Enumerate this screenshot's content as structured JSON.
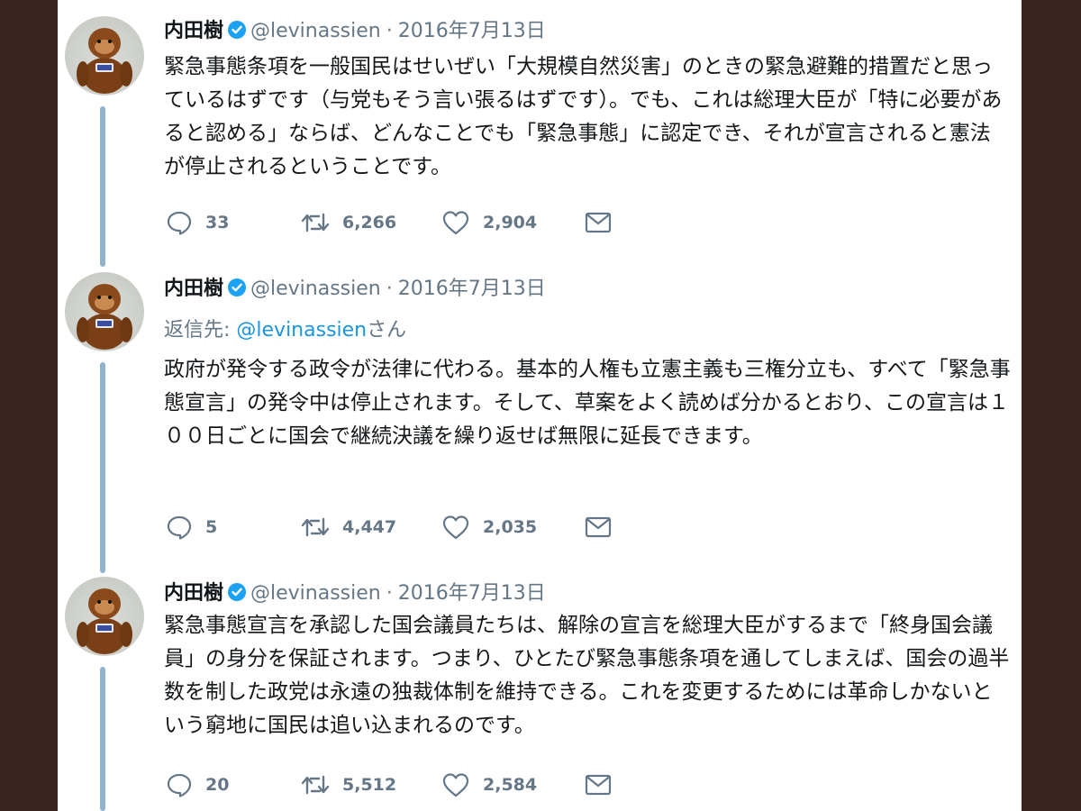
{
  "tweets": [
    {
      "name": "内田樹",
      "handle": "@levinassien",
      "separator": "·",
      "date": "2016年7月13日",
      "text": "緊急事態条項を一般国民はせいぜい「大規模自然災害」のときの緊急避難的措置だと思っているはずです（与党もそう言い張るはずです）。でも、これは総理大臣が「特に必要があると認める」ならば、どんなことでも「緊急事態」に認定でき、それが宣言されると憲法が停止されるということです。",
      "replies": "33",
      "retweets": "6,266",
      "likes": "2,904"
    },
    {
      "name": "内田樹",
      "handle": "@levinassien",
      "separator": "·",
      "date": "2016年7月13日",
      "reply_prefix": "返信先: ",
      "reply_handle": "@levinassien",
      "reply_suffix": "さん",
      "text": "政府が発令する政令が法律に代わる。基本的人権も立憲主義も三権分立も、すべて「緊急事態宣言」の発令中は停止されます。そして、草案をよく読めば分かるとおり、この宣言は１００日ごとに国会で継続決議を繰り返せば無限に延長できます。",
      "replies": "5",
      "retweets": "4,447",
      "likes": "2,035"
    },
    {
      "name": "内田樹",
      "handle": "@levinassien",
      "separator": "·",
      "date": "2016年7月13日",
      "text": "緊急事態宣言を承認した国会議員たちは、解除の宣言を総理大臣がするまで「終身国会議員」の身分を保証されます。つまり、ひとたび緊急事態条項を通してしまえば、国会の過半数を制した政党は永遠の独裁体制を維持できる。これを変更するためには革命しかないという窮地に国民は追い込まれるのです。",
      "replies": "20",
      "retweets": "5,512",
      "likes": "2,584"
    }
  ],
  "icons": [
    "reply-icon",
    "retweet-icon",
    "like-icon",
    "message-icon",
    "verified-icon"
  ],
  "colors": {
    "verified": "#1da1f2",
    "thread_line": "#8fb2cf",
    "meta_text": "#657786",
    "link": "#1b95e0",
    "frame": "#3b2420"
  }
}
